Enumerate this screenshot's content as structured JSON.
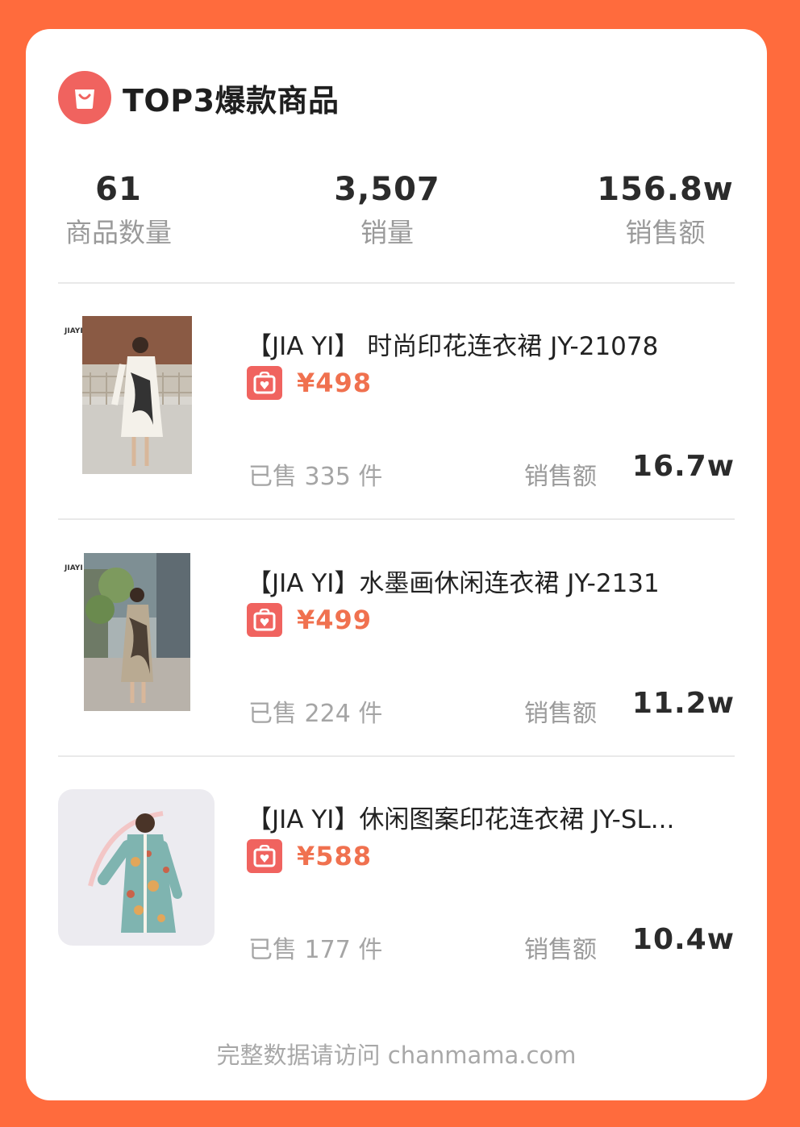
{
  "header": {
    "title": "TOP3爆款商品",
    "icon": "shopping-bag-icon"
  },
  "stats": [
    {
      "value": "61",
      "label": "商品数量"
    },
    {
      "value": "3,507",
      "label": "销量"
    },
    {
      "value": "156.8w",
      "label": "销售额"
    }
  ],
  "products": [
    {
      "title": "【JIA YI】 时尚印花连衣裙 JY-21078",
      "price": "¥498",
      "sold": "已售 335 件",
      "sales_label": "销售额",
      "sales_value": "16.7w",
      "brand_mark": "JIAYI"
    },
    {
      "title": "【JIA YI】水墨画休闲连衣裙 JY-2131",
      "price": "¥499",
      "sold": "已售 224 件",
      "sales_label": "销售额",
      "sales_value": "11.2w",
      "brand_mark": "JIAYI"
    },
    {
      "title": "【JIA YI】休闲图案印花连衣裙 JY-SL...",
      "price": "¥588",
      "sold": "已售 177 件",
      "sales_label": "销售额",
      "sales_value": "10.4w"
    }
  ],
  "footer": "完整数据请访问 chanmama.com",
  "colors": {
    "background": "#ff6b3d",
    "accent": "#f0635f",
    "price": "#f0714f"
  }
}
